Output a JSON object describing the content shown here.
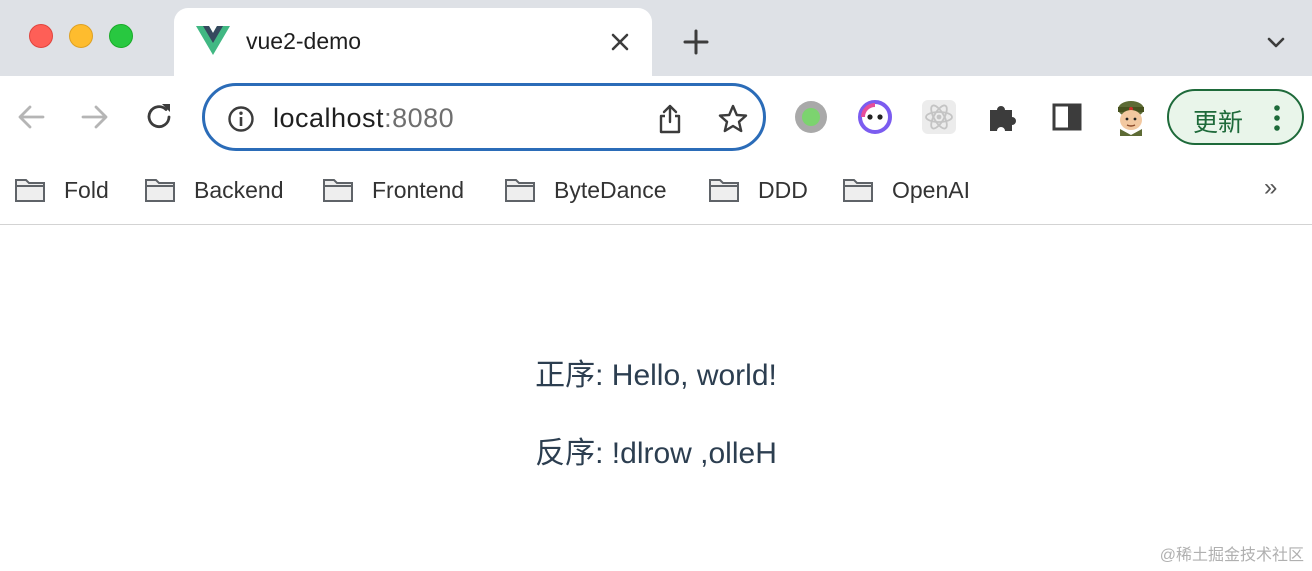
{
  "tab": {
    "title": "vue2-demo"
  },
  "address_bar": {
    "host": "localhost",
    "port": ":8080"
  },
  "toolbar": {
    "update_label": "更新"
  },
  "bookmarks": [
    "Fold",
    "Backend",
    "Frontend",
    "ByteDance",
    "DDD",
    "OpenAI"
  ],
  "bookmarks_more": "»",
  "content": {
    "forward_line": "正序: Hello, world!",
    "reverse_line": "反序: !dlrow ,olleH"
  },
  "watermark": "@稀土掘金技术社区",
  "colors": {
    "vue_green": "#41b883",
    "vue_dark": "#35495e",
    "accent_blue": "#2b6cb8",
    "update_green": "#1e6a3a"
  },
  "icons": [
    "vue-logo",
    "close-icon",
    "plus-icon",
    "chevron-down-icon",
    "back-arrow-icon",
    "forward-arrow-icon",
    "reload-icon",
    "info-icon",
    "share-icon",
    "star-icon",
    "puzzle-icon",
    "sidepanel-icon",
    "folder-icon"
  ]
}
